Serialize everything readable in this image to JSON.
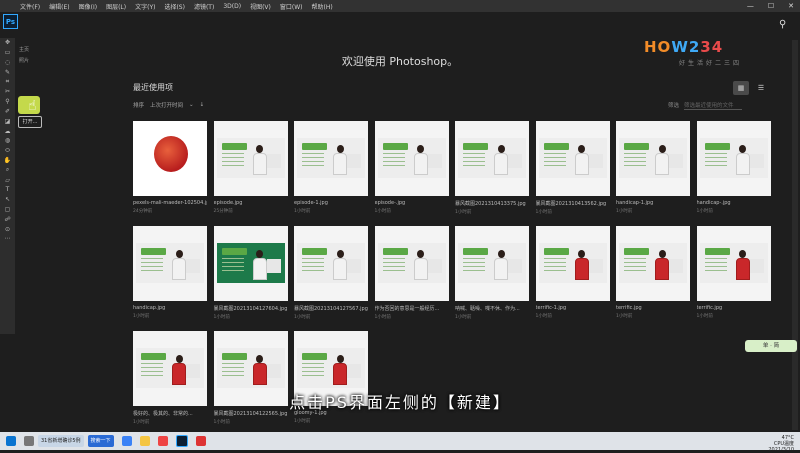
{
  "menu": [
    "文件(F)",
    "编辑(E)",
    "图像(I)",
    "图层(L)",
    "文字(Y)",
    "选择(S)",
    "滤镜(T)",
    "3D(D)",
    "视图(V)",
    "窗口(W)",
    "帮助(H)"
  ],
  "app_logo": "Ps",
  "side_items": [
    "主页",
    "学习",
    "云文档",
    "照片"
  ],
  "open_label": "打开...",
  "welcome": "欢迎使用 Photoshop。",
  "recent_title": "最近使用项",
  "sort_label": "排序",
  "sort_value": "上次打开时间",
  "filter_label": "筛选",
  "filter_placeholder": "筛选最近使用的文件",
  "files": [
    {
      "name": "pexels-mali-maeder-102504.jpg",
      "time": "24分钟前",
      "kind": "apple"
    },
    {
      "name": "episode.jpg",
      "time": "25分钟前",
      "kind": "slide"
    },
    {
      "name": "episode-1.jpg",
      "time": "1小时前",
      "kind": "slide"
    },
    {
      "name": "episode-.jpg",
      "time": "1小时前",
      "kind": "slide"
    },
    {
      "name": "暴风截图2021310413375.jpg",
      "time": "1小时前",
      "kind": "slide"
    },
    {
      "name": "暴风截图2021310413562.jpg",
      "time": "1小时前",
      "kind": "slide"
    },
    {
      "name": "handicap-1.jpg",
      "time": "1小时前",
      "kind": "slide"
    },
    {
      "name": "handicap-.jpg",
      "time": "1小时前",
      "kind": "slide"
    },
    {
      "name": "handicap.jpg",
      "time": "1小时前",
      "kind": "slide"
    },
    {
      "name": "暴风截图20213104127604.jpg",
      "time": "1小时前",
      "kind": "board"
    },
    {
      "name": "暴风截图20213104127567.jpg",
      "time": "1小时前",
      "kind": "slide"
    },
    {
      "name": "作为否回的意思是一般经历...",
      "time": "1小时前",
      "kind": "slide"
    },
    {
      "name": "呐喊、聒噪、喋不休、作为...",
      "time": "1小时前",
      "kind": "slide"
    },
    {
      "name": "terrific-1.jpg",
      "time": "1小时前",
      "kind": "red"
    },
    {
      "name": "terrific.jpg",
      "time": "1小时前",
      "kind": "red"
    },
    {
      "name": "terrific.jpg",
      "time": "1小时前",
      "kind": "red"
    },
    {
      "name": "极好的、极其的、非常的...",
      "time": "1小时前",
      "kind": "red"
    },
    {
      "name": "暴风截图20213104122565.jpg",
      "time": "1小时前",
      "kind": "red"
    },
    {
      "name": "gloomy-1.jpg",
      "time": "1小时前",
      "kind": "red"
    }
  ],
  "logo": {
    "text_a": "HO",
    "text_b": "W2",
    "text_c": "34",
    "sub": "好生活好二三四"
  },
  "subtitle": "点击PS界面左侧的【新建】",
  "right_badge": "单 · 简",
  "taskbar": {
    "app1": "31省新增确诊5例",
    "app2": "搜索一下",
    "weather": "47°C",
    "weather_label": "CPU温度",
    "date": "2021/3/10"
  }
}
